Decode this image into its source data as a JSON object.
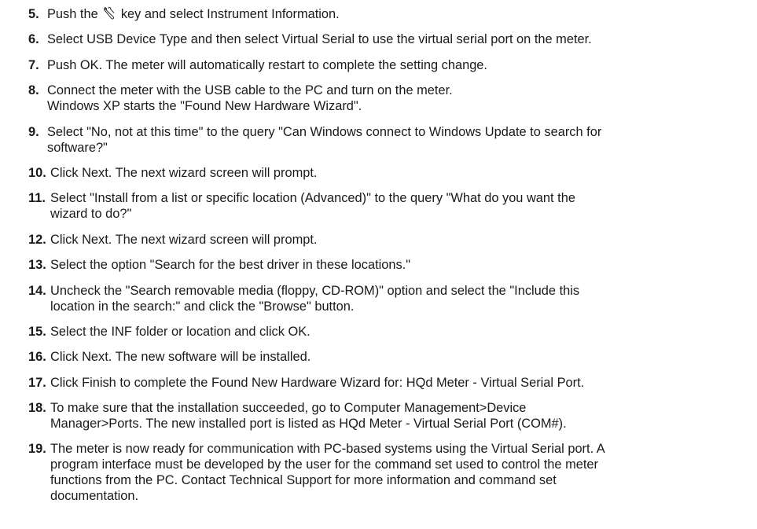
{
  "steps": [
    {
      "num": "5.",
      "pre": "Push the",
      "icon": "wrench-icon",
      "post": "key and select Instrument Information."
    },
    {
      "num": "6.",
      "lines": [
        "Select USB Device Type and then select Virtual Serial to use the virtual serial port on the meter."
      ]
    },
    {
      "num": "7.",
      "lines": [
        "Push OK. The meter will automatically restart to complete the setting change."
      ]
    },
    {
      "num": "8.",
      "lines": [
        "Connect the meter with the USB cable to the PC and turn on the meter.",
        "Windows XP starts the \"Found New Hardware Wizard\"."
      ]
    },
    {
      "num": "9.",
      "lines": [
        "Select \"No, not at this time\" to the query \"Can Windows connect to Windows Update to search for",
        "software?\""
      ]
    },
    {
      "num": "10.",
      "lines": [
        "Click Next. The next wizard screen will prompt."
      ]
    },
    {
      "num": "11.",
      "lines": [
        "Select \"Install from a list or specific location (Advanced)\" to the query \"What do you want the",
        "wizard to do?\""
      ]
    },
    {
      "num": "12.",
      "lines": [
        "Click Next. The next wizard screen will prompt."
      ]
    },
    {
      "num": "13.",
      "lines": [
        "Select the option \"Search for the best driver in these locations.\""
      ]
    },
    {
      "num": "14.",
      "lines": [
        "Uncheck the \"Search removable media (floppy, CD-ROM)\" option and select the \"Include this",
        "location in the search:\" and click the \"Browse\" button."
      ]
    },
    {
      "num": "15.",
      "lines": [
        "Select the INF folder or location and click OK."
      ]
    },
    {
      "num": "16.",
      "lines": [
        "Click Next. The new software will be installed."
      ]
    },
    {
      "num": "17.",
      "lines": [
        "Click Finish to complete the Found New Hardware Wizard for: HQd Meter - Virtual Serial Port."
      ]
    },
    {
      "num": "18.",
      "lines": [
        "To make sure that the installation succeeded, go to Computer Management>Device",
        "Manager>Ports. The new installed port is listed as HQd Meter - Virtual Serial Port (COM#)."
      ]
    },
    {
      "num": "19.",
      "lines": [
        "The meter is now ready for communication with PC-based systems using the Virtual Serial port. A",
        "program interface must be developed by the user for the command set used to control the meter",
        "functions from the PC. Contact Technical Support for more information and command set",
        "documentation."
      ]
    }
  ]
}
